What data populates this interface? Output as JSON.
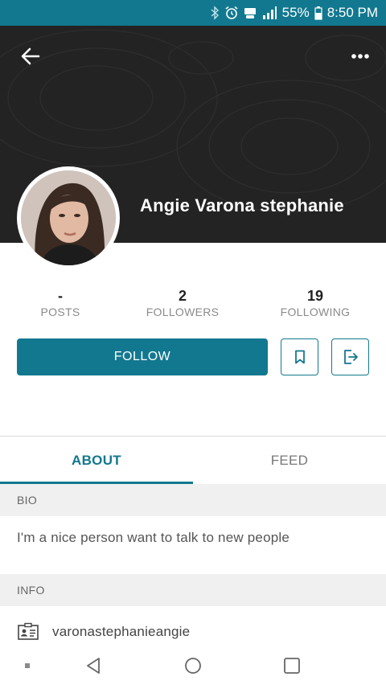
{
  "status_bar": {
    "battery": "55%",
    "time": "8:50 PM",
    "icons": [
      "bluetooth-icon",
      "alarm-icon",
      "lte-icon",
      "signal-icon",
      "battery-icon"
    ]
  },
  "header": {
    "back_icon": "arrow-left-icon",
    "more_icon": "more-horizontal-icon",
    "name": "Angie Varona stephanie"
  },
  "stats": [
    {
      "value": "-",
      "label": "POSTS"
    },
    {
      "value": "2",
      "label": "FOLLOWERS"
    },
    {
      "value": "19",
      "label": "FOLLOWING"
    }
  ],
  "actions": {
    "follow_label": "FOLLOW",
    "bookmark_icon": "bookmark-icon",
    "share_icon": "share-exit-icon"
  },
  "tabs": [
    {
      "label": "ABOUT",
      "active": true
    },
    {
      "label": "FEED",
      "active": false
    }
  ],
  "about": {
    "bio_header": "BIO",
    "bio": "I'm a nice person want to talk to new people",
    "info_header": "INFO",
    "username_icon": "id-card-icon",
    "username": "varonastephanieangie"
  },
  "nav": {
    "icons": [
      "menu-dot-icon",
      "back-triangle-icon",
      "home-circle-icon",
      "recents-square-icon"
    ]
  },
  "colors": {
    "accent": "#12788f",
    "header_bg": "#232323",
    "section_bg": "#f0f0f0"
  }
}
